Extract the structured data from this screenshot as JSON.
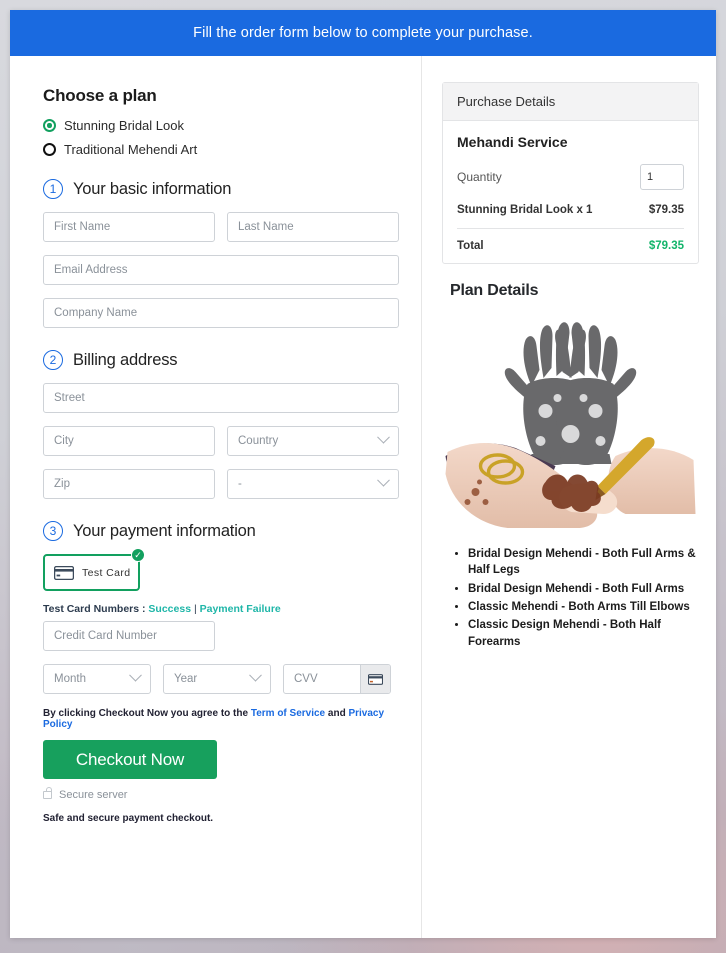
{
  "banner": {
    "text": "Fill the order form below to complete your purchase."
  },
  "plan": {
    "heading": "Choose a plan",
    "options": [
      {
        "label": "Stunning Bridal Look",
        "selected": true
      },
      {
        "label": "Traditional Mehendi Art",
        "selected": false
      }
    ]
  },
  "step1": {
    "number": "1",
    "title": "Your basic information",
    "fields": {
      "first_name": "First Name",
      "last_name": "Last Name",
      "email": "Email Address",
      "company": "Company Name"
    }
  },
  "step2": {
    "number": "2",
    "title": "Billing address",
    "fields": {
      "street": "Street",
      "city": "City",
      "country": "Country",
      "zip": "Zip",
      "state": "-"
    }
  },
  "step3": {
    "number": "3",
    "title": "Your payment information",
    "card_option": "Test  Card",
    "test_cards_label": "Test Card Numbers :",
    "test_success": "Success",
    "test_separator": "|",
    "test_failure": "Payment Failure",
    "fields": {
      "card_number": "Credit Card Number",
      "month": "Month",
      "year": "Year",
      "cvv": "CVV"
    }
  },
  "footer": {
    "agree_prefix": "By clicking Checkout Now you agree to the",
    "terms_link": "Term of Service",
    "agree_and": "and",
    "privacy_link": "Privacy Policy",
    "checkout_label": "Checkout Now",
    "secure_server": "Secure server",
    "safe_note": "Safe and secure payment checkout."
  },
  "purchase": {
    "header": "Purchase Details",
    "service": "Mehandi Service",
    "quantity_label": "Quantity",
    "quantity_value": "1",
    "line_item": "Stunning Bridal Look x 1",
    "line_amount": "$79.35",
    "total_label": "Total",
    "total_amount": "$79.35"
  },
  "plan_details": {
    "title": "Plan Details",
    "items": [
      "Bridal Design Mehendi - Both Full Arms & Half Legs",
      "Bridal Design Mehendi - Both Full Arms",
      "Classic Mehendi - Both Arms Till Elbows",
      "Classic Design Mehendi - Both Half Forearms"
    ]
  },
  "colors": {
    "banner_blue": "#1a6ae0",
    "accent_green": "#12a05f",
    "total_green": "#12b46a",
    "link_teal": "#1fb6a8",
    "link_blue": "#1a6ae0"
  }
}
